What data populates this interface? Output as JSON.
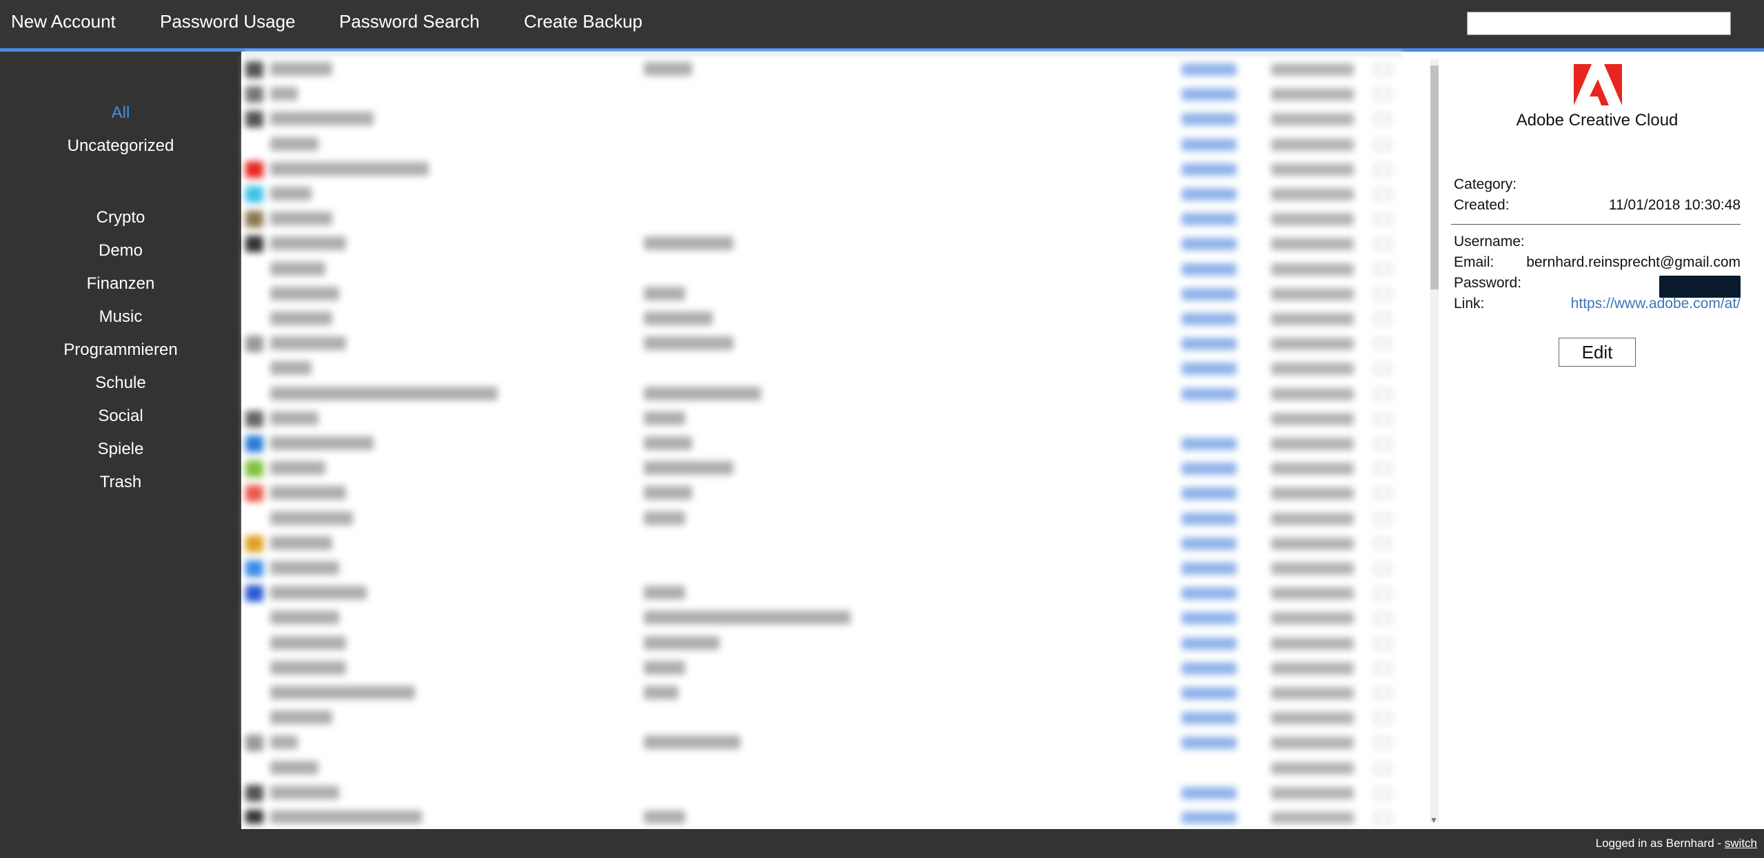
{
  "nav": {
    "new_account": "New Account",
    "password_usage": "Password Usage",
    "password_search": "Password Search",
    "create_backup": "Create Backup",
    "search_value": ""
  },
  "sidebar": {
    "items": [
      {
        "label": "All",
        "active": true
      },
      {
        "label": "Uncategorized",
        "active": false
      },
      {
        "label": "Crypto",
        "active": false
      },
      {
        "label": "Demo",
        "active": false
      },
      {
        "label": "Finanzen",
        "active": false
      },
      {
        "label": "Music",
        "active": false
      },
      {
        "label": "Programmieren",
        "active": false
      },
      {
        "label": "Schule",
        "active": false
      },
      {
        "label": "Social",
        "active": false
      },
      {
        "label": "Spiele",
        "active": false
      },
      {
        "label": "Trash",
        "active": false
      }
    ]
  },
  "list": {
    "blurred": true,
    "row_count": 31
  },
  "detail": {
    "logo_icon": "adobe-logo-icon",
    "title": "Adobe Creative Cloud",
    "category_label": "Category:",
    "category_value": "",
    "created_label": "Created:",
    "created_value": "11/01/2018 10:30:48",
    "username_label": "Username:",
    "username_value": "",
    "email_label": "Email:",
    "email_value": "bernhard.reinsprecht@gmail.com",
    "password_label": "Password:",
    "link_label": "Link:",
    "link_value": "https://www.adobe.com/at/",
    "edit_label": "Edit"
  },
  "footer": {
    "logged_in_text": "Logged in as Bernhard - ",
    "switch_label": "switch"
  },
  "colors": {
    "accent": "#4a8be6",
    "background": "#333333",
    "link": "#3a76b8",
    "adobe_red": "#e8251e",
    "password_mask": "#081a2b"
  }
}
